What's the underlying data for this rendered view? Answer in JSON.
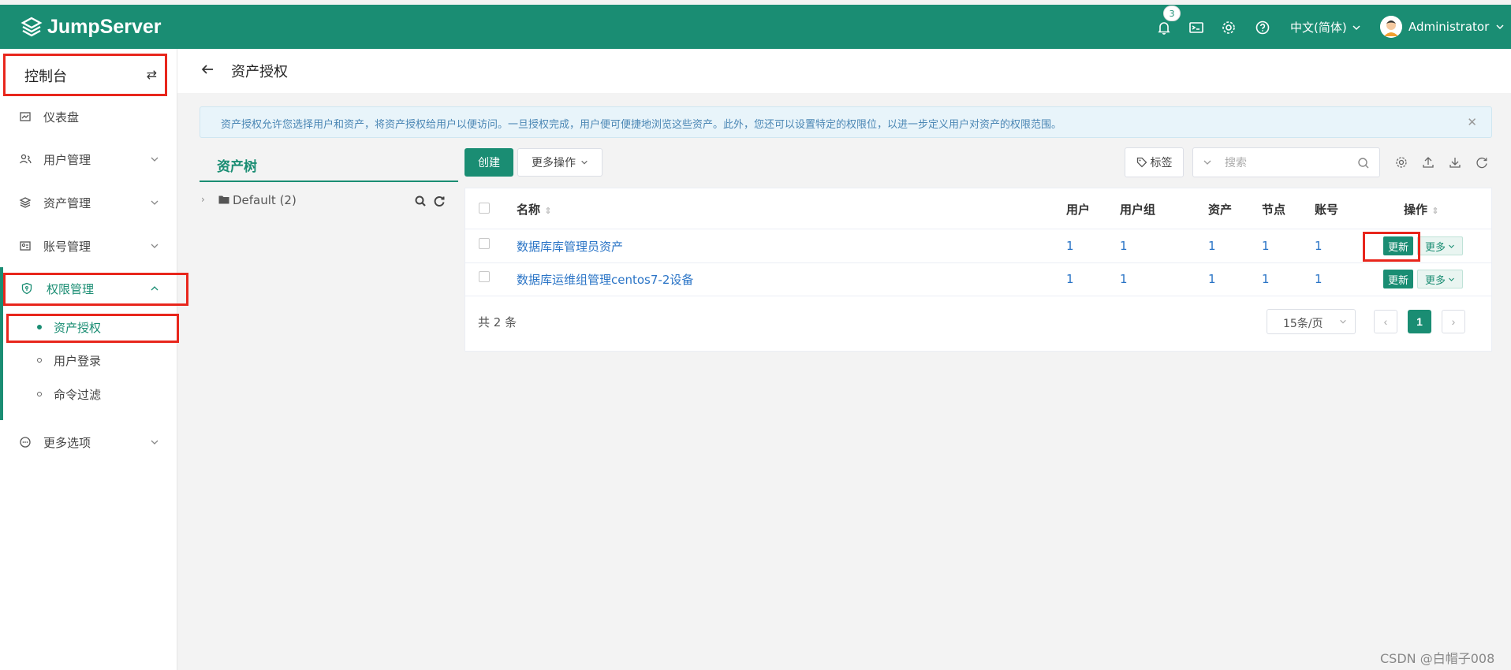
{
  "app": {
    "logo_text": "JumpServer",
    "notification_count": "3",
    "language": "中文(简体)",
    "user_name": "Administrator"
  },
  "sidebar": {
    "console_label": "控制台",
    "items": [
      {
        "label": "仪表盘",
        "icon": "dashboard-icon"
      },
      {
        "label": "用户管理",
        "icon": "users-icon"
      },
      {
        "label": "资产管理",
        "icon": "assets-icon"
      },
      {
        "label": "账号管理",
        "icon": "accounts-icon"
      },
      {
        "label": "权限管理",
        "icon": "shield-icon"
      },
      {
        "label": "更多选项",
        "icon": "more-icon"
      }
    ],
    "sub_items": [
      {
        "label": "资产授权"
      },
      {
        "label": "用户登录"
      },
      {
        "label": "命令过滤"
      }
    ]
  },
  "page": {
    "title": "资产授权",
    "info": "资产授权允许您选择用户和资产，将资产授权给用户以便访问。一旦授权完成，用户便可便捷地浏览这些资产。此外，您还可以设置特定的权限位，以进一步定义用户对资产的权限范围。"
  },
  "tree": {
    "tab_label": "资产树",
    "root_label": "Default (2)"
  },
  "toolbar": {
    "create_label": "创建",
    "more_actions_label": "更多操作",
    "tag_label": "标签",
    "search_placeholder": "搜索"
  },
  "table": {
    "headers": {
      "name": "名称",
      "users": "用户",
      "user_groups": "用户组",
      "assets": "资产",
      "nodes": "节点",
      "accounts": "账号",
      "actions": "操作"
    },
    "rows": [
      {
        "name": "数据库库管理员资产",
        "users": "1",
        "user_groups": "1",
        "assets": "1",
        "nodes": "1",
        "accounts": "1",
        "update_label": "更新",
        "more_label": "更多"
      },
      {
        "name": "数据库运维组管理centos7-2设备",
        "users": "1",
        "user_groups": "1",
        "assets": "1",
        "nodes": "1",
        "accounts": "1",
        "update_label": "更新",
        "more_label": "更多"
      }
    ]
  },
  "pagination": {
    "total": "共 2 条",
    "page_size": "15条/页",
    "current_page": "1"
  },
  "watermark": "CSDN @白帽子008",
  "colors": {
    "brand": "#1a8d73",
    "highlight": "#e8261c",
    "link": "#2a74c6"
  }
}
